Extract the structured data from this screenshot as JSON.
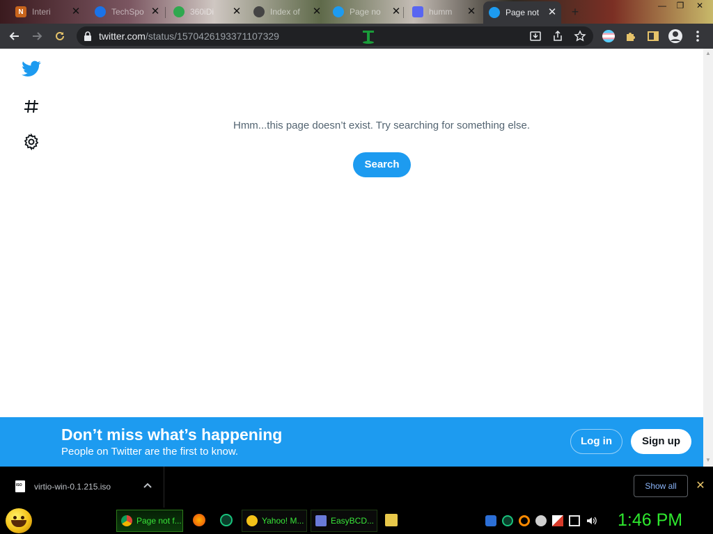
{
  "browser": {
    "tabs": [
      {
        "title": "Interi",
        "active": false
      },
      {
        "title": "TechSpo",
        "active": false
      },
      {
        "title": "360iDi",
        "active": false
      },
      {
        "title": "Index of",
        "active": false
      },
      {
        "title": "Page no",
        "active": false
      },
      {
        "title": "humm",
        "active": false
      },
      {
        "title": "Page not",
        "active": true
      }
    ],
    "new_tab_label": "+",
    "url_domain": "twitter.com",
    "url_path": "/status/1570426193371107329"
  },
  "page": {
    "message": "Hmm...this page doesn’t exist. Try searching for something else.",
    "search_button": "Search"
  },
  "banner": {
    "title": "Don’t miss what’s happening",
    "subtitle": "People on Twitter are the first to know.",
    "login": "Log in",
    "signup": "Sign up"
  },
  "downloads": {
    "file_name": "virtio-win-0.1.215.iso",
    "file_type": "ISO",
    "show_all": "Show all",
    "close": "✕"
  },
  "taskbar": {
    "apps": [
      {
        "label": "Page not f...",
        "active": true
      },
      {
        "label": "Yahoo! M...",
        "active": false
      },
      {
        "label": "EasyBCD...",
        "active": false
      }
    ],
    "clock": "1:46 PM"
  },
  "colors": {
    "twitter_blue": "#1d9bf0",
    "chrome_dark": "#35363a",
    "taskbar_green": "#2ee82e"
  }
}
